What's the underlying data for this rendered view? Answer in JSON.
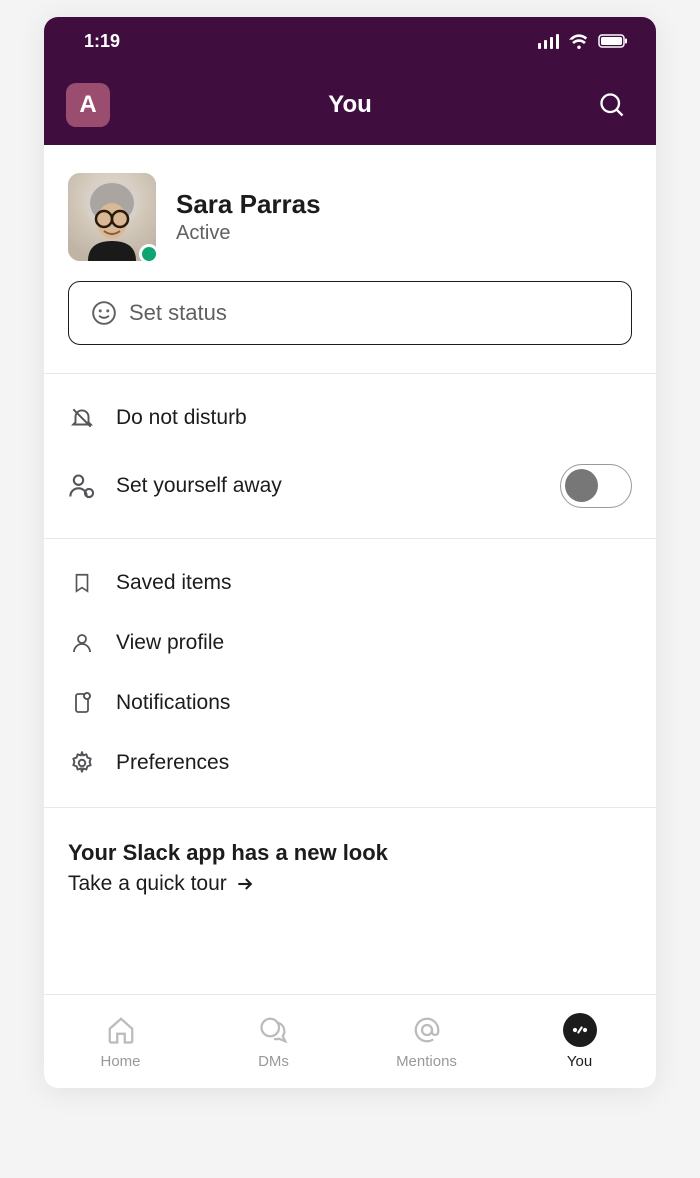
{
  "statusBar": {
    "time": "1:19"
  },
  "header": {
    "workspaceLetter": "A",
    "title": "You"
  },
  "profile": {
    "name": "Sara Parras",
    "presence": "Active"
  },
  "statusInput": {
    "placeholder": "Set status"
  },
  "menu": {
    "dnd": "Do not disturb",
    "away": "Set yourself away",
    "awayToggle": false,
    "saved": "Saved items",
    "viewProfile": "View profile",
    "notifications": "Notifications",
    "preferences": "Preferences"
  },
  "promo": {
    "title": "Your Slack app has a new look",
    "linkText": "Take a quick tour"
  },
  "nav": {
    "home": "Home",
    "dms": "DMs",
    "mentions": "Mentions",
    "you": "You"
  }
}
